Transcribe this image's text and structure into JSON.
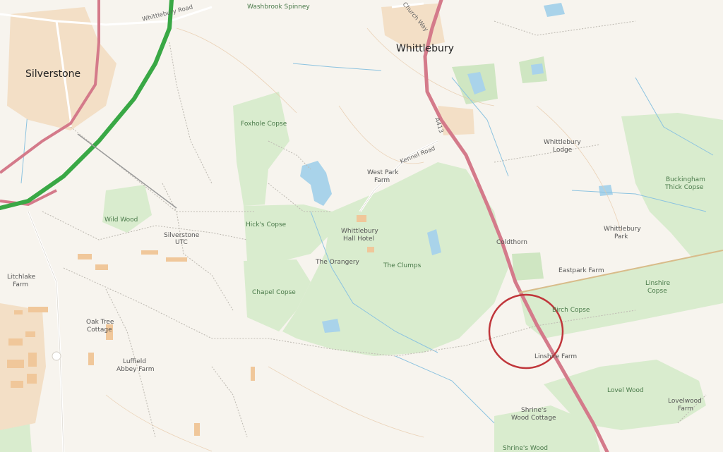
{
  "colors": {
    "background": "#f7f4ee",
    "woodland": "#d9ecce",
    "woodland_dark": "#c8e3bb",
    "park": "#e3f0da",
    "water": "#a9d3ea",
    "motorway": "#39a845",
    "a_road": "#d47a8a",
    "minor_road": "#ffffff",
    "track": "#b9b5ae",
    "building": "#f0c79a",
    "contour": "#e7c9a9",
    "marker": "#c0363b"
  },
  "places": {
    "silverstone": "Silverstone",
    "whittlebury": "Whittlebury"
  },
  "roads": {
    "whittlebury_road": "Whittlebury Road",
    "church_way": "Church Way",
    "kennel_road": "Kennel Road",
    "a413": "A413"
  },
  "features": {
    "washbrook_spinney": "Washbrook Spinney",
    "foxhole_copse": "Foxhole Copse",
    "west_park_farm": "West Park\nFarm",
    "whittlebury_lodge": "Whittlebury\nLodge",
    "buckingham_thick_copse": "Buckingham\nThick Copse",
    "wild_wood": "Wild Wood",
    "hicks_copse": "Hick's Copse",
    "whittlebury_hall_hotel": "Whittlebury\nHall Hotel",
    "silverstone_utc": "Silverstone\nUTC",
    "whittlebury_park": "Whittlebury\nPark",
    "coldthorn": "Coldthorn",
    "the_orangery": "The Orangery",
    "the_clumps": "The Clumps",
    "eastpark_farm": "Eastpark Farm",
    "litchlake_farm": "Litchlake\nFarm",
    "chapel_copse": "Chapel Copse",
    "linshire_copse": "Linshire\nCopse",
    "birch_copse": "Birch Copse",
    "oak_tree_cottage": "Oak Tree\nCottage",
    "linshire_farm": "Linshire Farm",
    "luffield_abbey_farm": "Luffield\nAbbey Farm",
    "lovel_wood": "Lovel Wood",
    "lovelwood_farm": "Lovelwood\nFarm",
    "shrines_wood_cottage": "Shrine's\nWood Cottage",
    "shrines_wood": "Shrine's Wood"
  },
  "marker": {
    "shape": "circle",
    "style": "outline"
  }
}
